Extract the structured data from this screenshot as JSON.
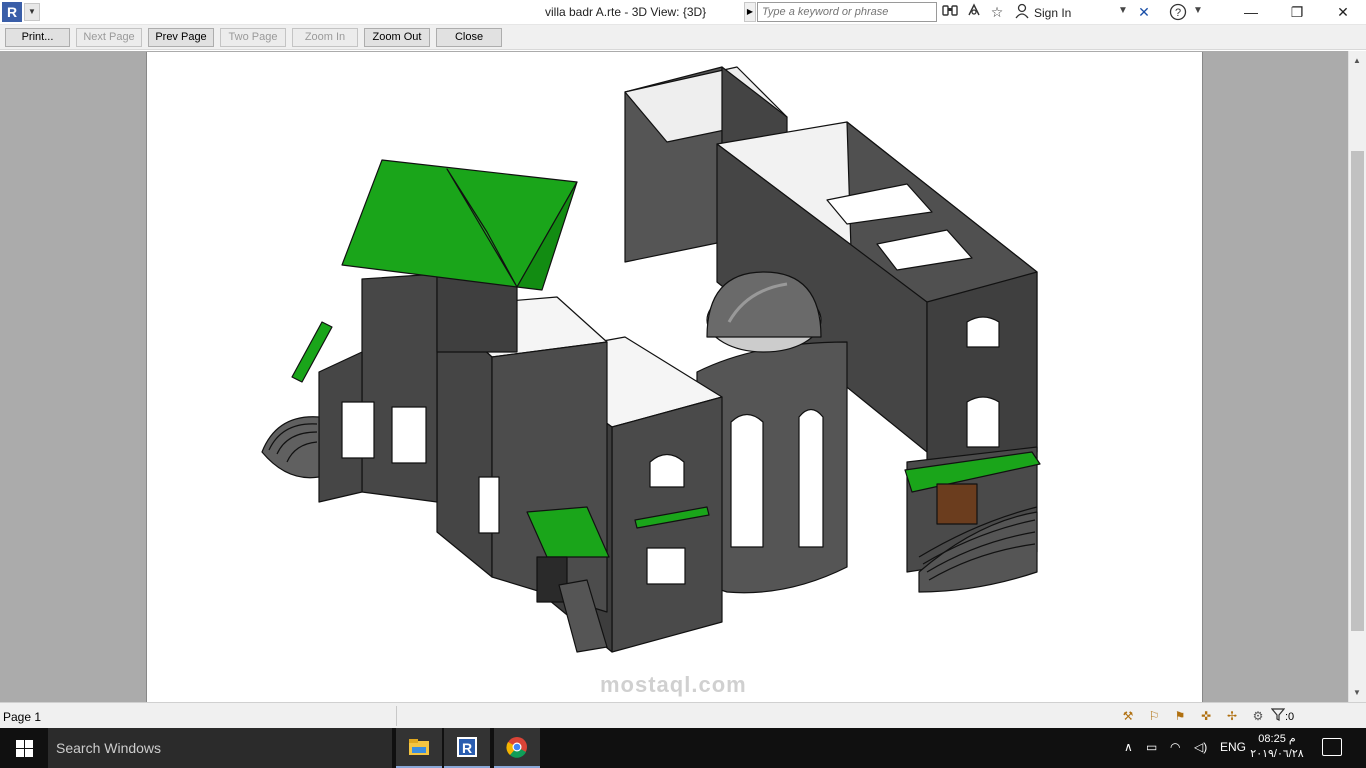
{
  "titlebar": {
    "title": "villa badr A.rte - 3D View: {3D}",
    "search_placeholder": "Type a keyword or phrase",
    "sign_in": "Sign In",
    "app_letter": "R"
  },
  "toolbar": {
    "print": "Print...",
    "next_page": "Next Page",
    "prev_page": "Prev Page",
    "two_page": "Two Page",
    "zoom_in": "Zoom In",
    "zoom_out": "Zoom Out",
    "close": "Close"
  },
  "statusbar": {
    "page": "Page 1",
    "filter_count": ":0"
  },
  "taskbar": {
    "search": "Search Windows",
    "lang": "ENG",
    "time": "08:25 م",
    "date": "٢٠١٩/٠٦/٢٨"
  },
  "watermark": "mostaql.com",
  "colors": {
    "roof_green": "#1aa51a",
    "wall_gray": "#4d4d4d",
    "viewport_gray": "#ababab"
  }
}
